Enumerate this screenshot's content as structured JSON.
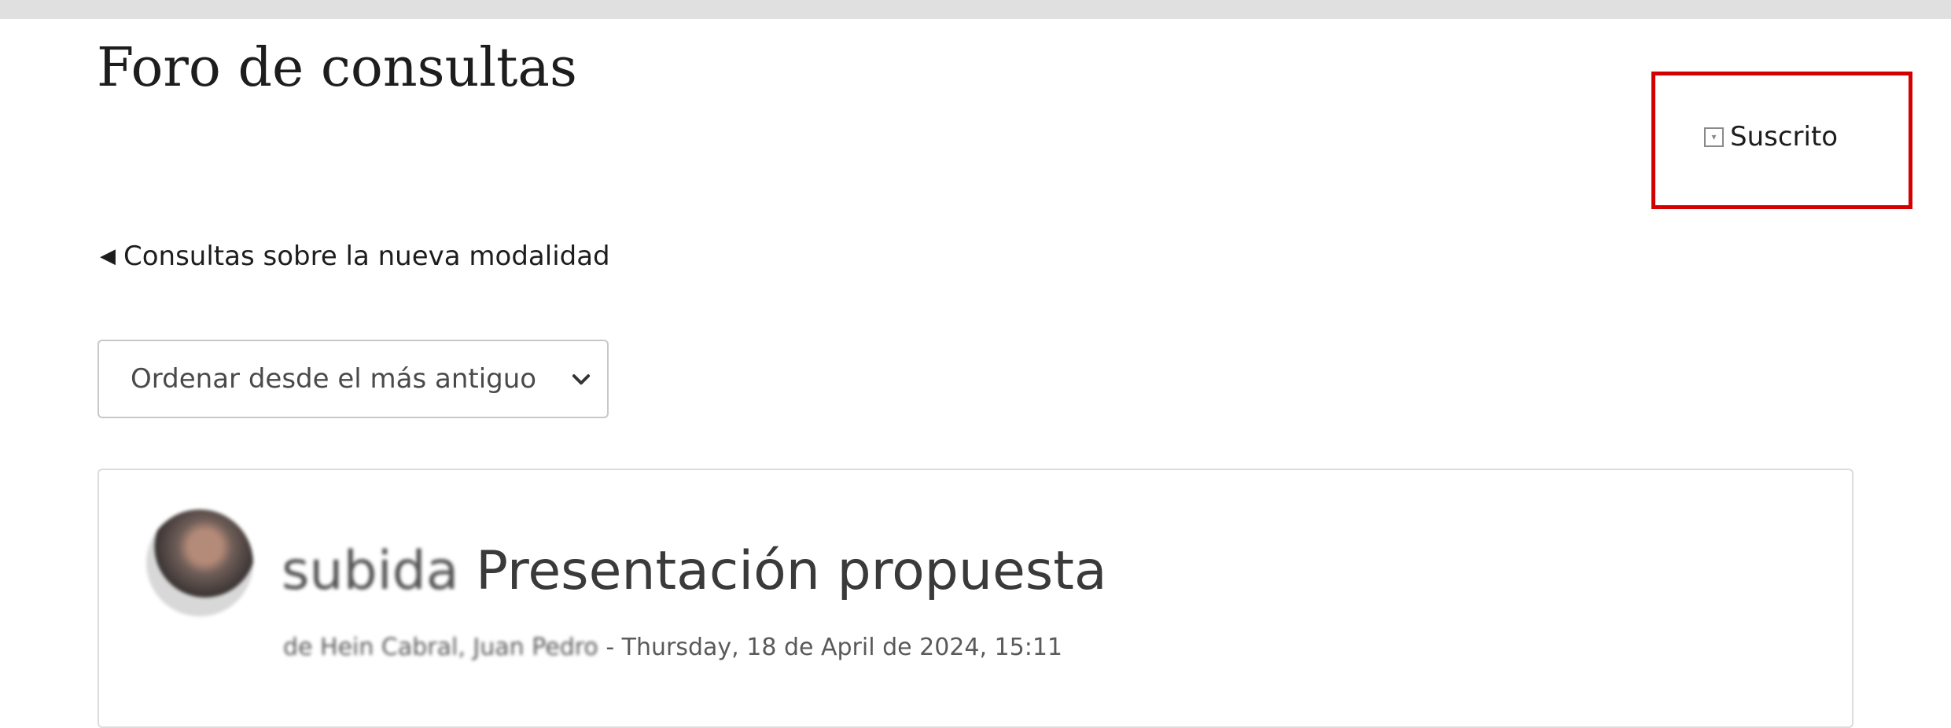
{
  "page": {
    "title": "Foro de consultas"
  },
  "subscription": {
    "label": "Suscrito"
  },
  "navigation": {
    "back_label": "Consultas sobre la nueva modalidad"
  },
  "sort": {
    "selected": "Ordenar desde el más antiguo"
  },
  "post": {
    "title_prefix": "subida",
    "title": "Presentación propuesta",
    "author_prefix": "de Hein Cabral, Juan Pedro",
    "date": " - Thursday, 18 de April de 2024, 15:11"
  },
  "colors": {
    "highlight": "#d40000",
    "topbar": "#e0e0e0"
  }
}
